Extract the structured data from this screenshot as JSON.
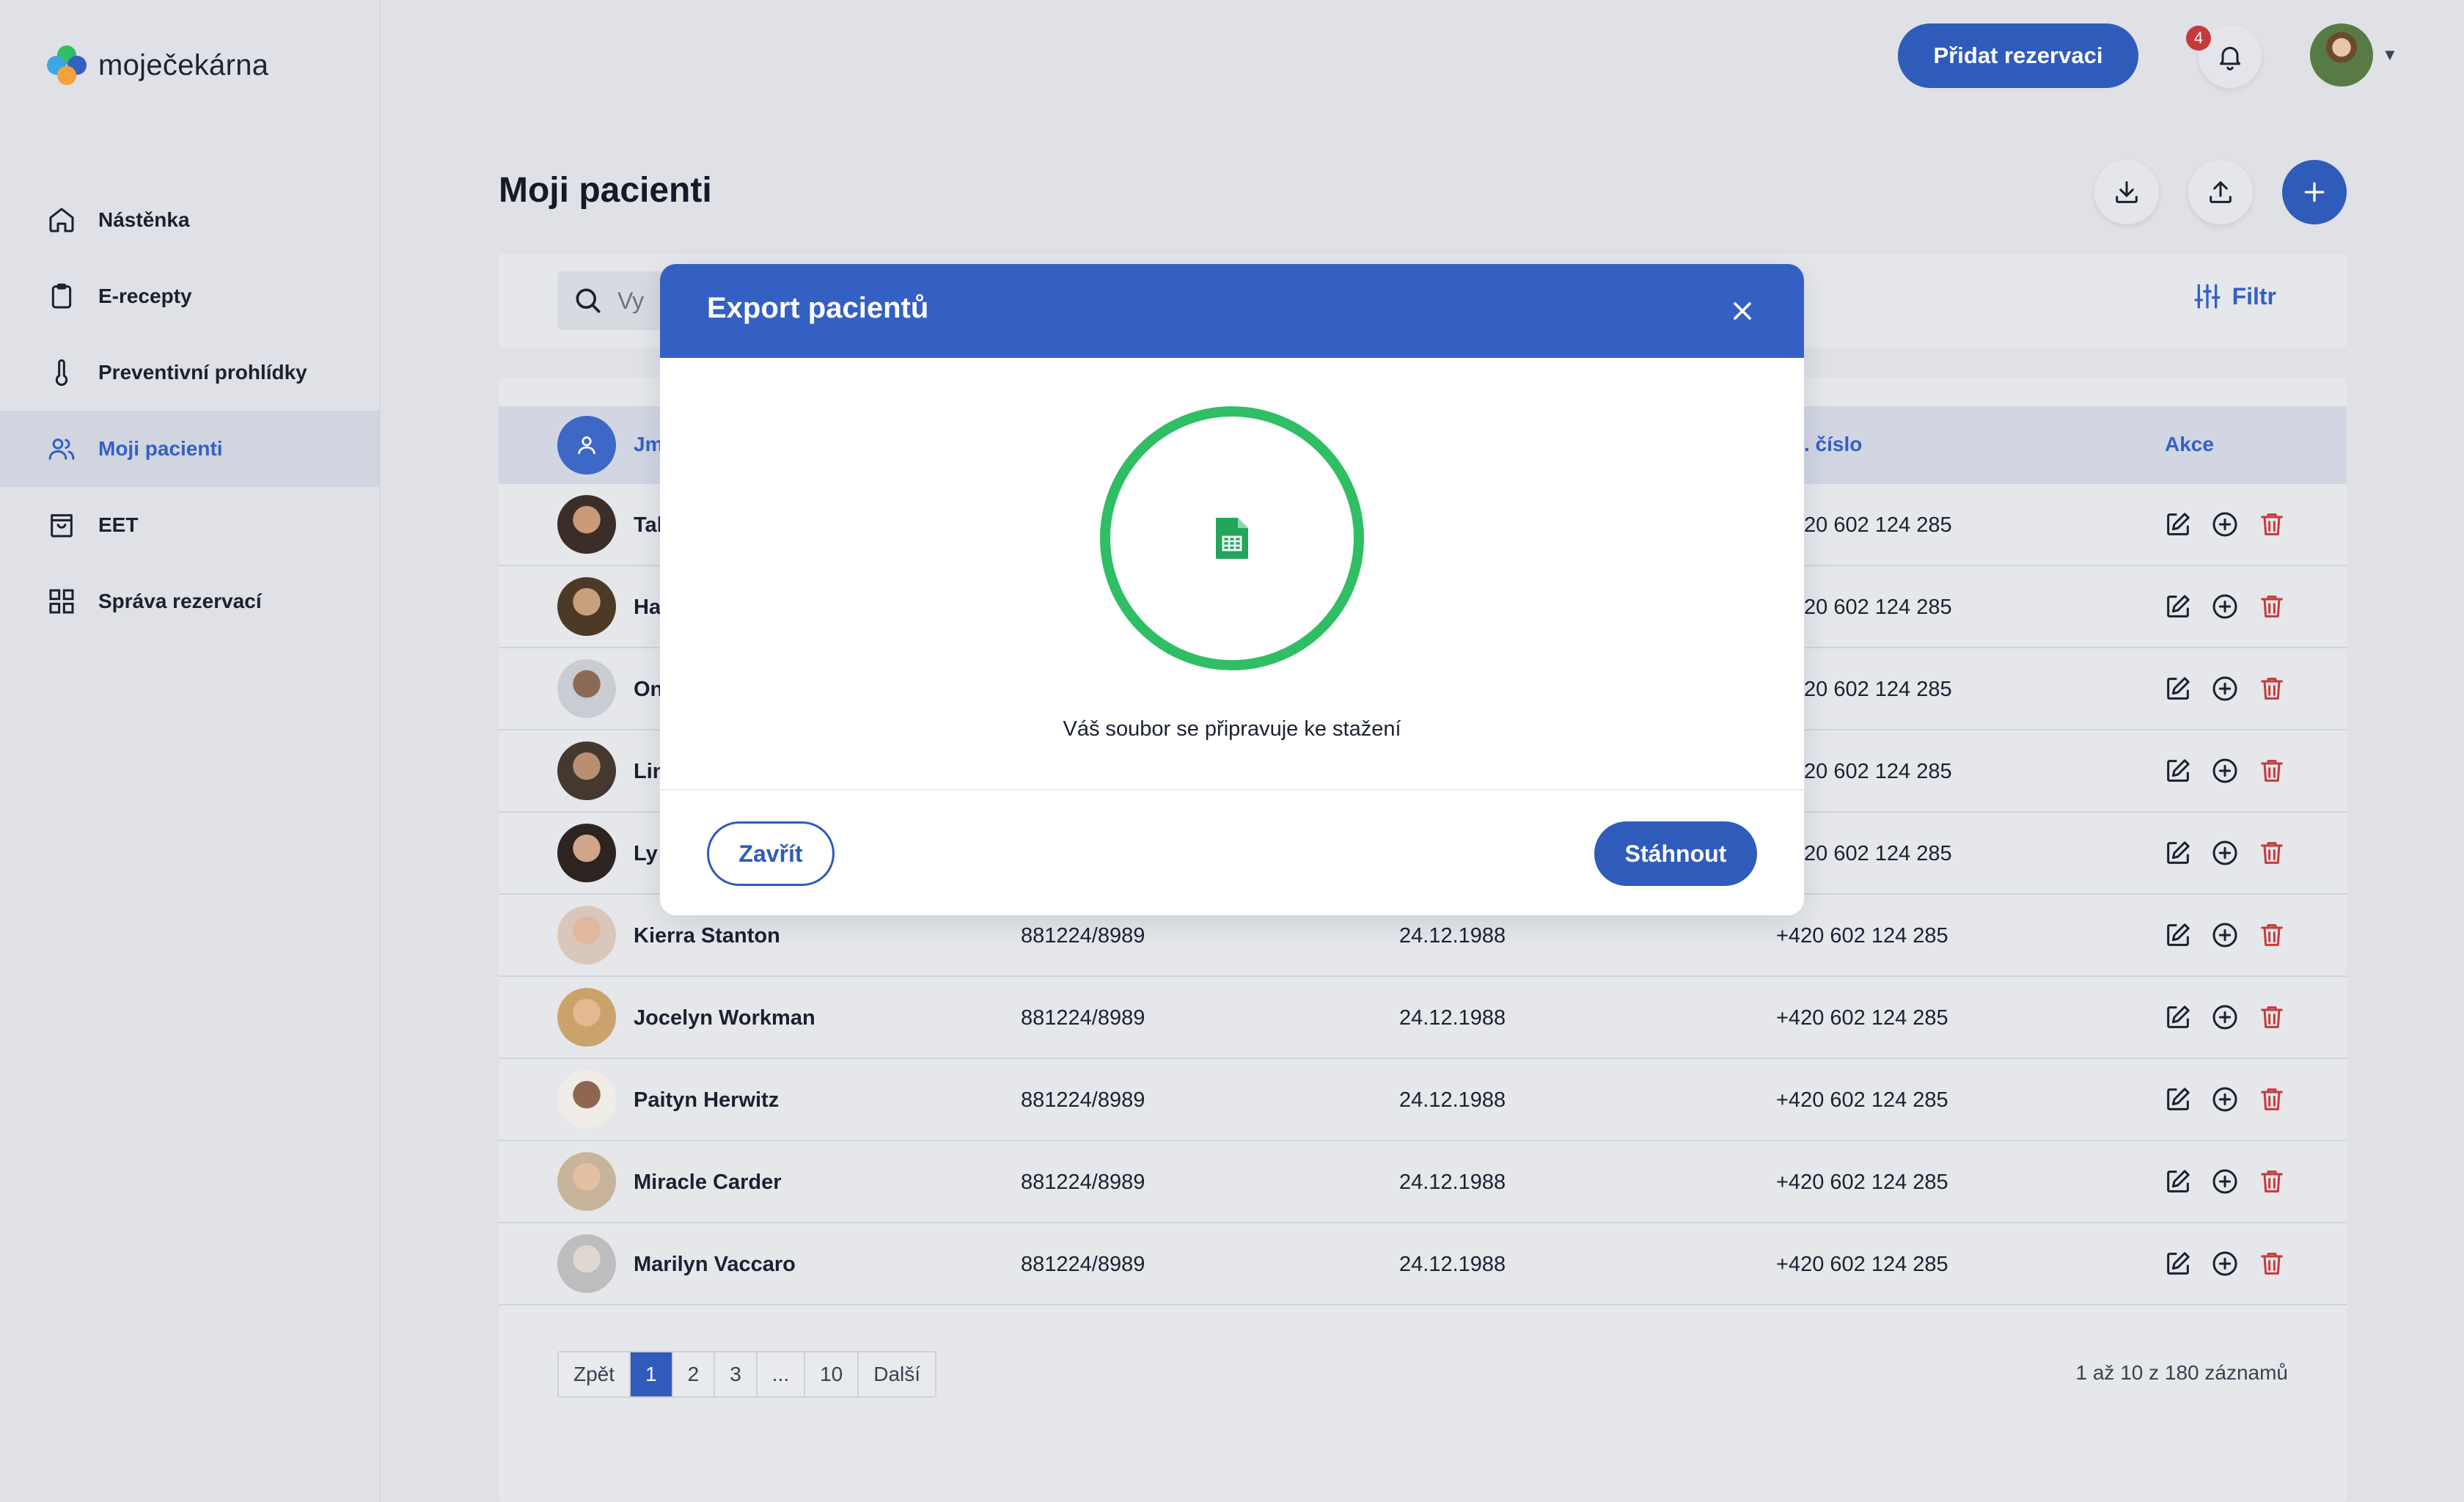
{
  "brand": {
    "name": "moječekárna"
  },
  "sidebar": {
    "items": [
      {
        "label": "Nástěnka",
        "icon": "home-icon",
        "active": false
      },
      {
        "label": "E-recepty",
        "icon": "clipboard-icon",
        "active": false
      },
      {
        "label": "Preventivní prohlídky",
        "icon": "thermometer-icon",
        "active": false
      },
      {
        "label": "Moji pacienti",
        "icon": "users-icon",
        "active": true
      },
      {
        "label": "EET",
        "icon": "shopping-bag-icon",
        "active": false
      },
      {
        "label": "Správa rezervací",
        "icon": "grid-icon",
        "active": false
      }
    ]
  },
  "header": {
    "add_reservation_label": "Přidat rezervaci",
    "notification_count": "4"
  },
  "page": {
    "title": "Moji pacienti",
    "search_partial": "Vy",
    "filter_label": "Filtr"
  },
  "table": {
    "columns": {
      "name_partial": "Jm",
      "phone_partial": ". číslo",
      "actions": "Akce"
    },
    "rows": [
      {
        "name": "Tal",
        "birth_no": "",
        "date": "",
        "phone": "20 602 124 285"
      },
      {
        "name": "Ha",
        "birth_no": "",
        "date": "",
        "phone": "20 602 124 285"
      },
      {
        "name": "On",
        "birth_no": "",
        "date": "",
        "phone": "20 602 124 285"
      },
      {
        "name": "Lin",
        "birth_no": "",
        "date": "",
        "phone": "20 602 124 285"
      },
      {
        "name": "Ly",
        "birth_no": "",
        "date": "",
        "phone": "20 602 124 285"
      },
      {
        "name": "Kierra Stanton",
        "birth_no": "881224/8989",
        "date": "24.12.1988",
        "phone": "+420 602 124 285"
      },
      {
        "name": "Jocelyn Workman",
        "birth_no": "881224/8989",
        "date": "24.12.1988",
        "phone": "+420 602 124 285"
      },
      {
        "name": "Paityn Herwitz",
        "birth_no": "881224/8989",
        "date": "24.12.1988",
        "phone": "+420 602 124 285"
      },
      {
        "name": "Miracle Carder",
        "birth_no": "881224/8989",
        "date": "24.12.1988",
        "phone": "+420 602 124 285"
      },
      {
        "name": "Marilyn Vaccaro",
        "birth_no": "881224/8989",
        "date": "24.12.1988",
        "phone": "+420 602 124 285"
      }
    ]
  },
  "pagination": {
    "prev": "Zpět",
    "pages": [
      "1",
      "2",
      "3",
      "...",
      "10"
    ],
    "current": "1",
    "next": "Další",
    "summary": "1 až 10 z 180 záznamů"
  },
  "modal": {
    "title": "Export pacientů",
    "message": "Váš soubor se připravuje ke stažení",
    "close_label": "Zavřít",
    "download_label": "Stáhnout"
  },
  "colors": {
    "primary": "#2f5bbb",
    "modal_header": "#3560c3",
    "progress_ring": "#2fbe63",
    "delete": "#c73a3a",
    "background": "#dfe1e6"
  }
}
